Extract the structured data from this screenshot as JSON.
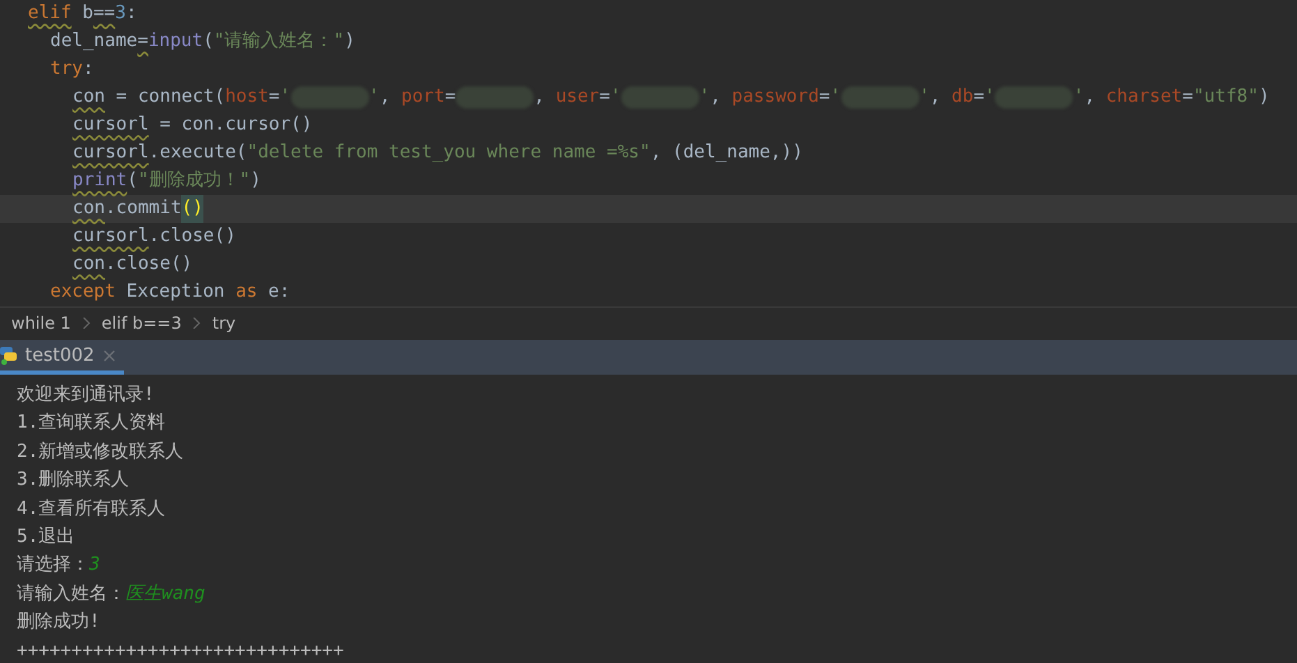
{
  "editor": {
    "lines": [
      {
        "current": false,
        "tokens": [
          {
            "kind": "keyword",
            "text": "elif",
            "warn": true
          },
          {
            "kind": "plain",
            "text": " b",
            "warn": false
          },
          {
            "kind": "plain",
            "text": "==",
            "warn": true
          },
          {
            "kind": "number",
            "text": "3",
            "warn": false
          },
          {
            "kind": "plain",
            "text": ":",
            "warn": false
          }
        ],
        "children": [
          {
            "current": false,
            "tokens": [
              {
                "kind": "plain",
                "text": "del_name",
                "warn": false
              },
              {
                "kind": "plain",
                "text": "=",
                "warn": true
              },
              {
                "kind": "builtin",
                "text": "input",
                "warn": false
              },
              {
                "kind": "plain",
                "text": "(",
                "warn": false
              },
              {
                "kind": "string",
                "text": "\"请输入姓名：\"",
                "warn": false
              },
              {
                "kind": "plain",
                "text": ")",
                "warn": false
              }
            ]
          },
          {
            "current": false,
            "tokens": [
              {
                "kind": "keyword",
                "text": "try",
                "warn": false
              },
              {
                "kind": "plain",
                "text": ":",
                "warn": false
              }
            ],
            "children": [
              {
                "current": false,
                "tokens": [
                  {
                    "kind": "plain",
                    "text": "con",
                    "warn": true
                  },
                  {
                    "kind": "plain",
                    "text": " = connect(",
                    "warn": false
                  },
                  {
                    "kind": "param",
                    "text": "host",
                    "warn": false
                  },
                  {
                    "kind": "plain",
                    "text": "=",
                    "warn": false
                  },
                  {
                    "kind": "string",
                    "text": "'",
                    "warn": false
                  },
                  {
                    "kind": "redacted",
                    "warn": false
                  },
                  {
                    "kind": "string",
                    "text": "'",
                    "warn": false
                  },
                  {
                    "kind": "plain",
                    "text": ", ",
                    "warn": false
                  },
                  {
                    "kind": "param",
                    "text": "port",
                    "warn": false
                  },
                  {
                    "kind": "plain",
                    "text": "=",
                    "warn": false
                  },
                  {
                    "kind": "redacted",
                    "warn": false
                  },
                  {
                    "kind": "plain",
                    "text": ", ",
                    "warn": false
                  },
                  {
                    "kind": "param",
                    "text": "user",
                    "warn": false
                  },
                  {
                    "kind": "plain",
                    "text": "=",
                    "warn": false
                  },
                  {
                    "kind": "string",
                    "text": "'",
                    "warn": false
                  },
                  {
                    "kind": "redacted",
                    "warn": false
                  },
                  {
                    "kind": "string",
                    "text": "'",
                    "warn": false
                  },
                  {
                    "kind": "plain",
                    "text": ", ",
                    "warn": false
                  },
                  {
                    "kind": "param",
                    "text": "password",
                    "warn": false
                  },
                  {
                    "kind": "plain",
                    "text": "=",
                    "warn": false
                  },
                  {
                    "kind": "string",
                    "text": "'",
                    "warn": false
                  },
                  {
                    "kind": "redacted",
                    "warn": false
                  },
                  {
                    "kind": "string",
                    "text": "'",
                    "warn": false
                  },
                  {
                    "kind": "plain",
                    "text": ", ",
                    "warn": false
                  },
                  {
                    "kind": "param",
                    "text": "db",
                    "warn": false
                  },
                  {
                    "kind": "plain",
                    "text": "=",
                    "warn": false
                  },
                  {
                    "kind": "string",
                    "text": "'",
                    "warn": false
                  },
                  {
                    "kind": "redacted",
                    "warn": false
                  },
                  {
                    "kind": "string",
                    "text": "'",
                    "warn": false
                  },
                  {
                    "kind": "plain",
                    "text": ", ",
                    "warn": false
                  },
                  {
                    "kind": "param",
                    "text": "charset",
                    "warn": false
                  },
                  {
                    "kind": "plain",
                    "text": "=",
                    "warn": false
                  },
                  {
                    "kind": "string",
                    "text": "\"utf8\"",
                    "warn": false
                  },
                  {
                    "kind": "plain",
                    "text": ")",
                    "warn": false
                  }
                ]
              },
              {
                "current": false,
                "tokens": [
                  {
                    "kind": "plain",
                    "text": "cursorl",
                    "warn": true
                  },
                  {
                    "kind": "plain",
                    "text": " = con.cursor()",
                    "warn": false
                  }
                ]
              },
              {
                "current": false,
                "tokens": [
                  {
                    "kind": "plain",
                    "text": "cursorl",
                    "warn": true
                  },
                  {
                    "kind": "plain",
                    "text": ".execute(",
                    "warn": false
                  },
                  {
                    "kind": "string",
                    "text": "\"delete from test_you where name =%s\"",
                    "warn": false
                  },
                  {
                    "kind": "plain",
                    "text": ", (del_name,))",
                    "warn": false
                  }
                ]
              },
              {
                "current": false,
                "tokens": [
                  {
                    "kind": "builtin",
                    "text": "print",
                    "warn": true
                  },
                  {
                    "kind": "plain",
                    "text": "(",
                    "warn": false
                  },
                  {
                    "kind": "string",
                    "text": "\"删除成功！\"",
                    "warn": false
                  },
                  {
                    "kind": "plain",
                    "text": ")",
                    "warn": false
                  }
                ]
              },
              {
                "current": true,
                "tokens": [
                  {
                    "kind": "plain",
                    "text": "con",
                    "warn": true
                  },
                  {
                    "kind": "plain",
                    "text": ".commit",
                    "warn": false
                  },
                  {
                    "kind": "matched",
                    "text": "()",
                    "warn": false
                  }
                ]
              },
              {
                "current": false,
                "tokens": [
                  {
                    "kind": "plain",
                    "text": "cursorl",
                    "warn": true
                  },
                  {
                    "kind": "plain",
                    "text": ".close()",
                    "warn": false
                  }
                ]
              },
              {
                "current": false,
                "tokens": [
                  {
                    "kind": "plain",
                    "text": "con",
                    "warn": true
                  },
                  {
                    "kind": "plain",
                    "text": ".close()",
                    "warn": false
                  }
                ]
              }
            ]
          },
          {
            "current": false,
            "tokens": [
              {
                "kind": "keyword",
                "text": "except",
                "warn": false
              },
              {
                "kind": "plain",
                "text": " Exception ",
                "warn": false
              },
              {
                "kind": "keyword",
                "text": "as",
                "warn": false
              },
              {
                "kind": "plain",
                "text": " e:",
                "warn": false
              }
            ]
          }
        ]
      }
    ]
  },
  "breadcrumbs": [
    "while 1",
    "elif b==3",
    "try"
  ],
  "run_tabs": [
    {
      "label": "test002",
      "selected": true
    }
  ],
  "console": {
    "lines": [
      {
        "segments": [
          {
            "kind": "output",
            "text": "欢迎来到通讯录!"
          }
        ]
      },
      {
        "segments": [
          {
            "kind": "output",
            "text": "1.查询联系人资料"
          }
        ]
      },
      {
        "segments": [
          {
            "kind": "output",
            "text": "2.新增或修改联系人"
          }
        ]
      },
      {
        "segments": [
          {
            "kind": "output",
            "text": "3.删除联系人"
          }
        ]
      },
      {
        "segments": [
          {
            "kind": "output",
            "text": "4.查看所有联系人"
          }
        ]
      },
      {
        "segments": [
          {
            "kind": "output",
            "text": "5.退出"
          }
        ]
      },
      {
        "segments": [
          {
            "kind": "output",
            "text": "请选择："
          },
          {
            "kind": "input",
            "text": "3"
          }
        ]
      },
      {
        "segments": [
          {
            "kind": "output",
            "text": "请输入姓名："
          },
          {
            "kind": "input",
            "text": "医生wang"
          }
        ]
      },
      {
        "segments": [
          {
            "kind": "output",
            "text": "删除成功!"
          }
        ]
      },
      {
        "segments": [
          {
            "kind": "output",
            "text": "++++++++++++++++++++++++++++++"
          }
        ]
      }
    ]
  }
}
